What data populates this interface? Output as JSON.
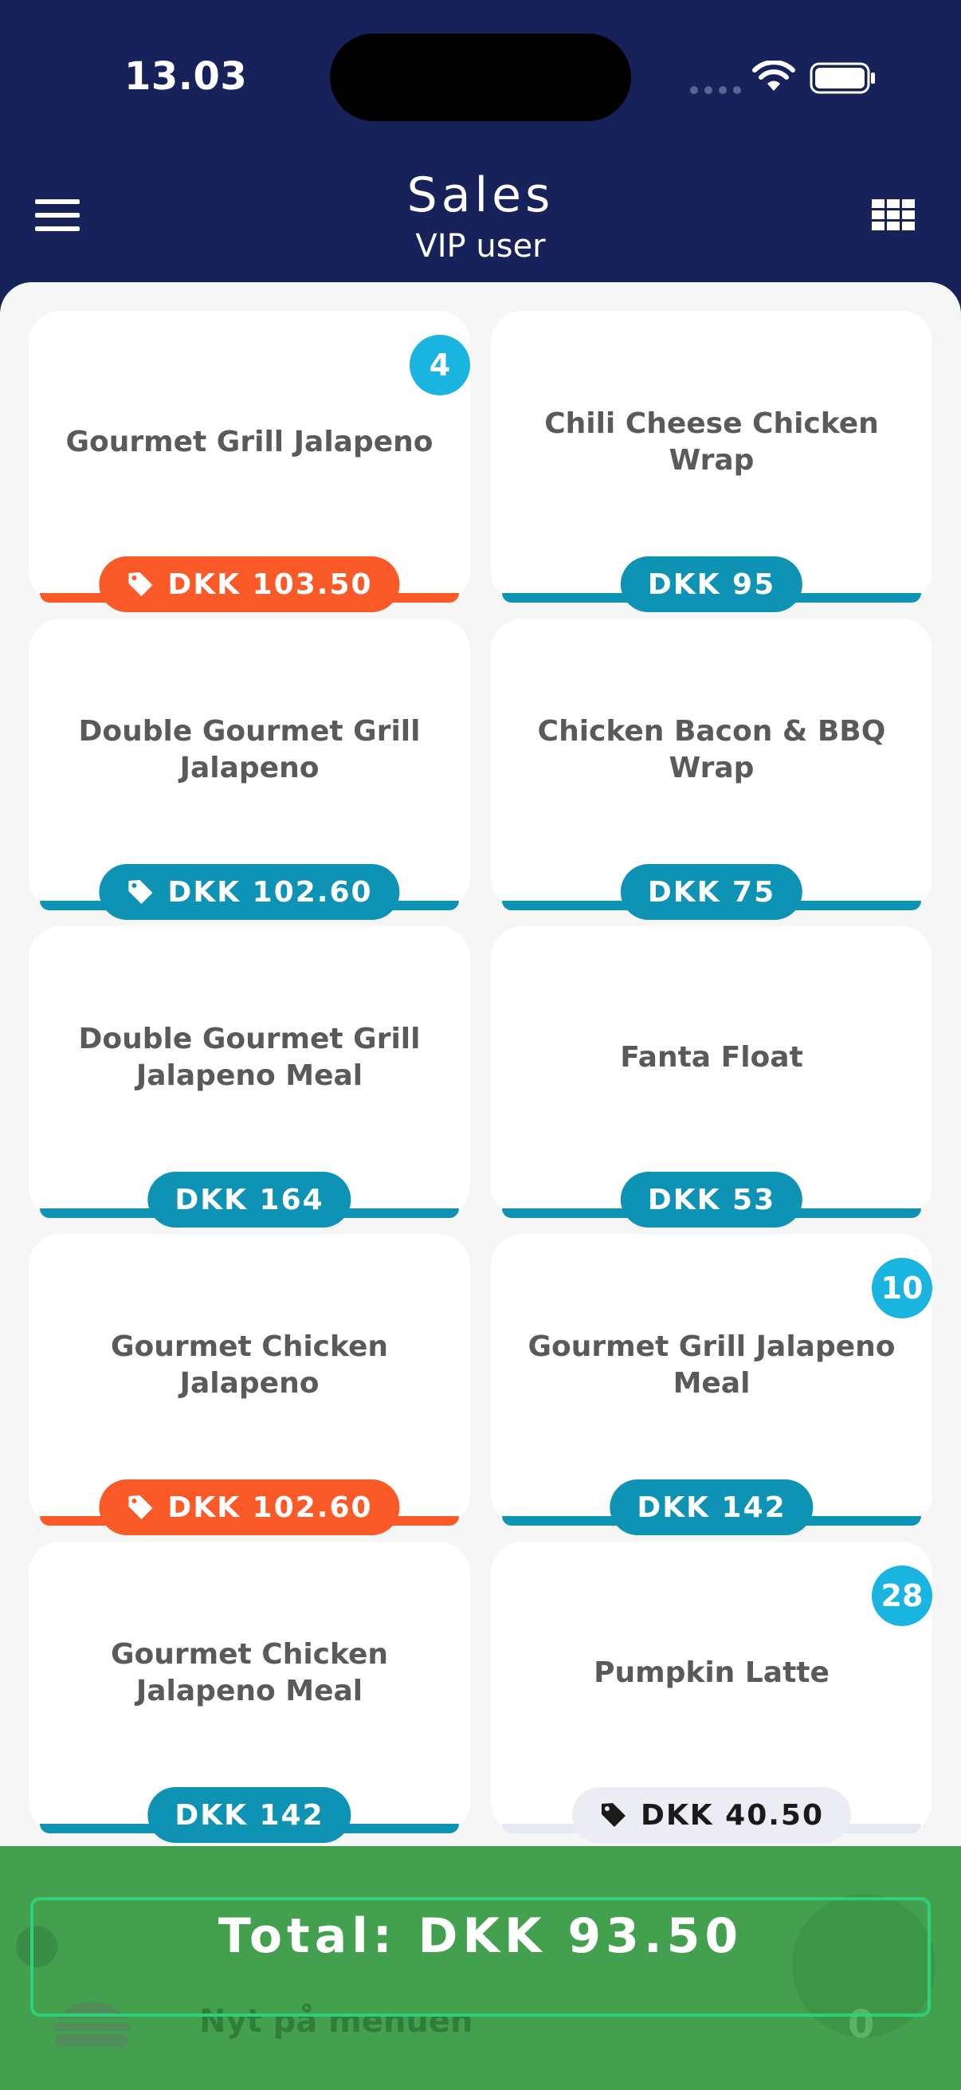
{
  "status_bar": {
    "time": "13.03"
  },
  "header": {
    "title": "Sales",
    "subtitle": "VIP user"
  },
  "colors": {
    "header_bg": "#17215a",
    "accent_blue": "#0e93b4",
    "accent_orange": "#fa5a28",
    "badge": "#1ab4e0",
    "footer": "#43a04e"
  },
  "products": [
    {
      "name": "Gourmet Grill Jalapeno",
      "price": "DKK 103.50",
      "style": "discount",
      "badge": "4"
    },
    {
      "name": "Chili Cheese Chicken Wrap",
      "price": "DKK 95",
      "style": "normal",
      "badge": ""
    },
    {
      "name": "Double Gourmet Grill Jalapeno",
      "price": "DKK 102.60",
      "style": "tagged",
      "badge": ""
    },
    {
      "name": "Chicken Bacon & BBQ Wrap",
      "price": "DKK 75",
      "style": "normal",
      "badge": ""
    },
    {
      "name": "Double Gourmet Grill Jalapeno Meal",
      "price": "DKK 164",
      "style": "normal",
      "badge": ""
    },
    {
      "name": "Fanta Float",
      "price": "DKK 53",
      "style": "normal",
      "badge": ""
    },
    {
      "name": "Gourmet Chicken Jalapeno",
      "price": "DKK 102.60",
      "style": "discount",
      "badge": ""
    },
    {
      "name": "Gourmet Grill Jalapeno Meal",
      "price": "DKK 142",
      "style": "normal",
      "badge": "10"
    },
    {
      "name": "Gourmet Chicken Jalapeno Meal",
      "price": "DKK 142",
      "style": "normal",
      "badge": ""
    },
    {
      "name": "Pumpkin Latte",
      "price": "DKK 40.50",
      "style": "light",
      "badge": "28"
    }
  ],
  "footer": {
    "total": "Total: DKK 93.50",
    "background_item": "Nyt på menuen",
    "background_count": "0"
  }
}
